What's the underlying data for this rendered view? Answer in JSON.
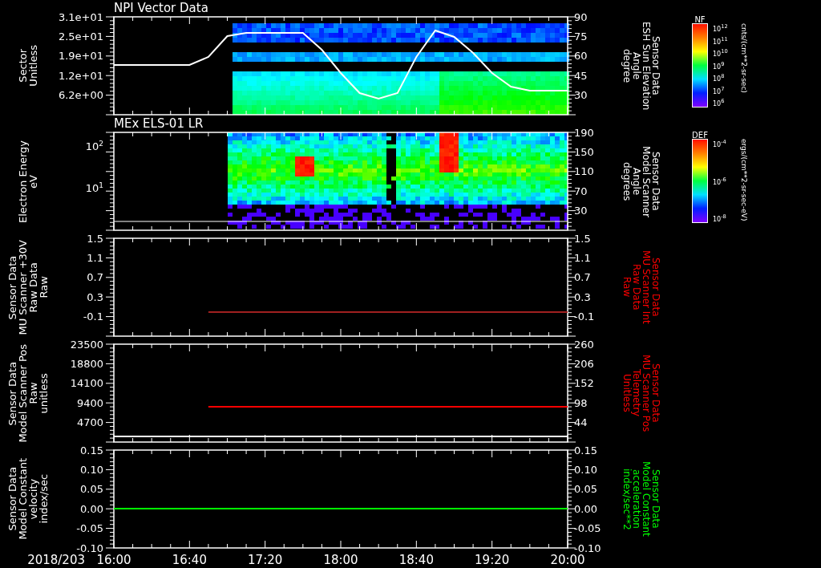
{
  "date_label": "2018/203",
  "panels": [
    {
      "kind": "sector",
      "title": "NPI Vector Data",
      "left_label": [
        "Sector",
        "Unitless"
      ],
      "left_ticks": [
        "3.1e+01",
        "2.5e+01",
        "1.9e+01",
        "1.2e+01",
        "6.2e+00"
      ],
      "right_label": {
        "lines": [
          "Sensor Data",
          "ESH Sun Elevation",
          "Angle",
          "degree"
        ],
        "color": "#ffffff"
      },
      "colorbar": {
        "title": "NF",
        "ticks": [
          "10$^{12}$",
          "10$^{11}$",
          "10$^{10}$",
          "10$^{9}$",
          "10$^{8}$",
          "10$^{7}$",
          "10$^{6}$"
        ],
        "unit": "cnts/(cm**2-sr-sec)"
      },
      "chart_data": {
        "type": "line",
        "categories": [
          null,
          null,
          null,
          null,
          null,
          null,
          null,
          null,
          null,
          null,
          null,
          null,
          null,
          null,
          null,
          null,
          null,
          null,
          null,
          null,
          null,
          null,
          null,
          null,
          null
        ],
        "ylim": [
          15,
          90
        ],
        "yticks": [
          90,
          75,
          60,
          45,
          30
        ],
        "series": [
          {
            "color": "#ffffff",
            "values": [
              53,
              53,
              53,
              53,
              53,
              59,
              75,
              77.7,
              77.7,
              77.7,
              77.4,
              65,
              47,
              31.6,
              27.3,
              31.6,
              59,
              79.5,
              74.6,
              62.3,
              47,
              36.5,
              33.4,
              33.4,
              33.4
            ]
          }
        ]
      }
    },
    {
      "kind": "spectrogram",
      "title": "MEx ELS-01 LR",
      "left_label": [
        "Electron Energy",
        "eV"
      ],
      "left_ticks": [
        "10$^{2}$",
        "10$^{1}$"
      ],
      "right_ticks": [
        "190",
        "150",
        "110",
        "70",
        "30"
      ],
      "right_label": {
        "lines": [
          "Sensor Data",
          "Model Scanner",
          "Angle",
          "degrees"
        ],
        "color": "#ffffff"
      },
      "colorbar": {
        "title": "DEF",
        "ticks": [
          "10$^{-4}$",
          "10$^{-6}$",
          "10$^{-8}$"
        ],
        "unit": "ergs/(cm**2-sr-sec-eV)"
      }
    },
    {
      "kind": "line",
      "left_label": [
        "Sensor Data",
        "MU Scanner +30V",
        "Raw Data",
        "Raw"
      ],
      "right_ticks": [
        "1.5",
        "1.1",
        "0.7",
        "0.3",
        "-0.1"
      ],
      "right_label": {
        "lines": [
          "Sensor Data",
          "MU Scanner Int",
          "Raw Data",
          "Raw"
        ],
        "color": "#ff0000"
      },
      "chart_data": {
        "type": "line",
        "categories": [
          null,
          null,
          null,
          null,
          null,
          null,
          null,
          null,
          null,
          null,
          null,
          null,
          null,
          null,
          null,
          null,
          null,
          null,
          null,
          null,
          null,
          null,
          null,
          null,
          null
        ],
        "ylim": [
          -0.5,
          1.5
        ],
        "yticks": [
          {
            "value": 1.5,
            "label": "1.5"
          },
          {
            "value": 1.1,
            "label": "1.1"
          },
          {
            "value": 0.7,
            "label": "0.7"
          },
          {
            "value": 0.3,
            "label": "0.3"
          },
          {
            "value": -0.1,
            "label": "-0.1"
          }
        ],
        "series": [
          {
            "color": "#a02020",
            "values": [
              null,
              null,
              null,
              null,
              null,
              0,
              0,
              0,
              0,
              0,
              0,
              0,
              0,
              0,
              0,
              0,
              0,
              0,
              0,
              0,
              0,
              0,
              0,
              0,
              0
            ]
          }
        ]
      }
    },
    {
      "kind": "line",
      "left_label": [
        "Sensor Data",
        "Model Scanner Pos",
        "Raw",
        "unitless"
      ],
      "right_ticks": [
        "260",
        "206",
        "152",
        "98",
        "44"
      ],
      "right_label": {
        "lines": [
          "Sensor Data",
          "MU Scanner Pos",
          "Telemetry",
          "Unitless"
        ],
        "color": "#ff0000"
      },
      "chart_data": {
        "type": "line",
        "categories": [
          null,
          null,
          null,
          null,
          null,
          null,
          null,
          null,
          null,
          null,
          null,
          null,
          null,
          null,
          null,
          null,
          null,
          null,
          null,
          null,
          null,
          null,
          null,
          null,
          null
        ],
        "ylim": [
          0,
          23500
        ],
        "yticks": [
          23500,
          18800,
          14100,
          9400,
          4700
        ],
        "series": [
          {
            "color": "#ff0000",
            "values": [
              null,
              null,
              null,
              null,
              null,
              8500,
              8500,
              8500,
              8500,
              8500,
              8500,
              8500,
              8500,
              8500,
              8500,
              8500,
              8500,
              8500,
              8500,
              8500,
              8500,
              8500,
              8500,
              8500,
              8500
            ]
          },
          {
            "color": "#ffffff",
            "values": [
              1300,
              1300,
              1300,
              1300,
              1300,
              1300,
              1300,
              1300,
              1300,
              1300,
              1300,
              1300,
              1300,
              1300,
              1300,
              1300,
              1300,
              1300,
              1300,
              1300,
              1300,
              1300,
              1300,
              1300,
              1300
            ]
          }
        ]
      }
    },
    {
      "kind": "line",
      "left_label": [
        "Sensor Data",
        "Model Constant",
        "velocity",
        "index/sec"
      ],
      "right_ticks": [
        "0.15",
        "0.10",
        "0.05",
        "0.00",
        "-0.05",
        "-0.10"
      ],
      "right_label": {
        "lines": [
          "Sensor Data",
          "Model Constant",
          "acceleration",
          "index/sec**2"
        ],
        "color": "#00ff00"
      },
      "chart_data": {
        "type": "line",
        "categories": [
          "16:00",
          null,
          null,
          null,
          "16:40",
          null,
          null,
          null,
          "17:20",
          null,
          null,
          null,
          "18:00",
          null,
          null,
          null,
          "18:40",
          null,
          null,
          null,
          "19:20",
          null,
          null,
          null,
          "20:00"
        ],
        "ylim": [
          -0.1,
          0.15
        ],
        "yticks": [
          {
            "value": 0.15,
            "label": "0.15"
          },
          {
            "value": 0.1,
            "label": "0.10"
          },
          {
            "value": 0.05,
            "label": "0.05"
          },
          {
            "value": 0,
            "label": "0.00"
          },
          {
            "value": -0.05,
            "label": "-0.05"
          },
          {
            "value": -0.1,
            "label": "-0.10"
          }
        ],
        "series": [
          {
            "color": "#00ff00",
            "values": [
              0,
              0,
              0,
              0,
              0,
              0,
              0,
              0,
              0,
              0,
              0,
              0,
              0,
              0,
              0,
              0,
              0,
              0,
              0,
              0,
              0,
              0,
              0,
              0,
              0
            ]
          }
        ]
      }
    }
  ]
}
